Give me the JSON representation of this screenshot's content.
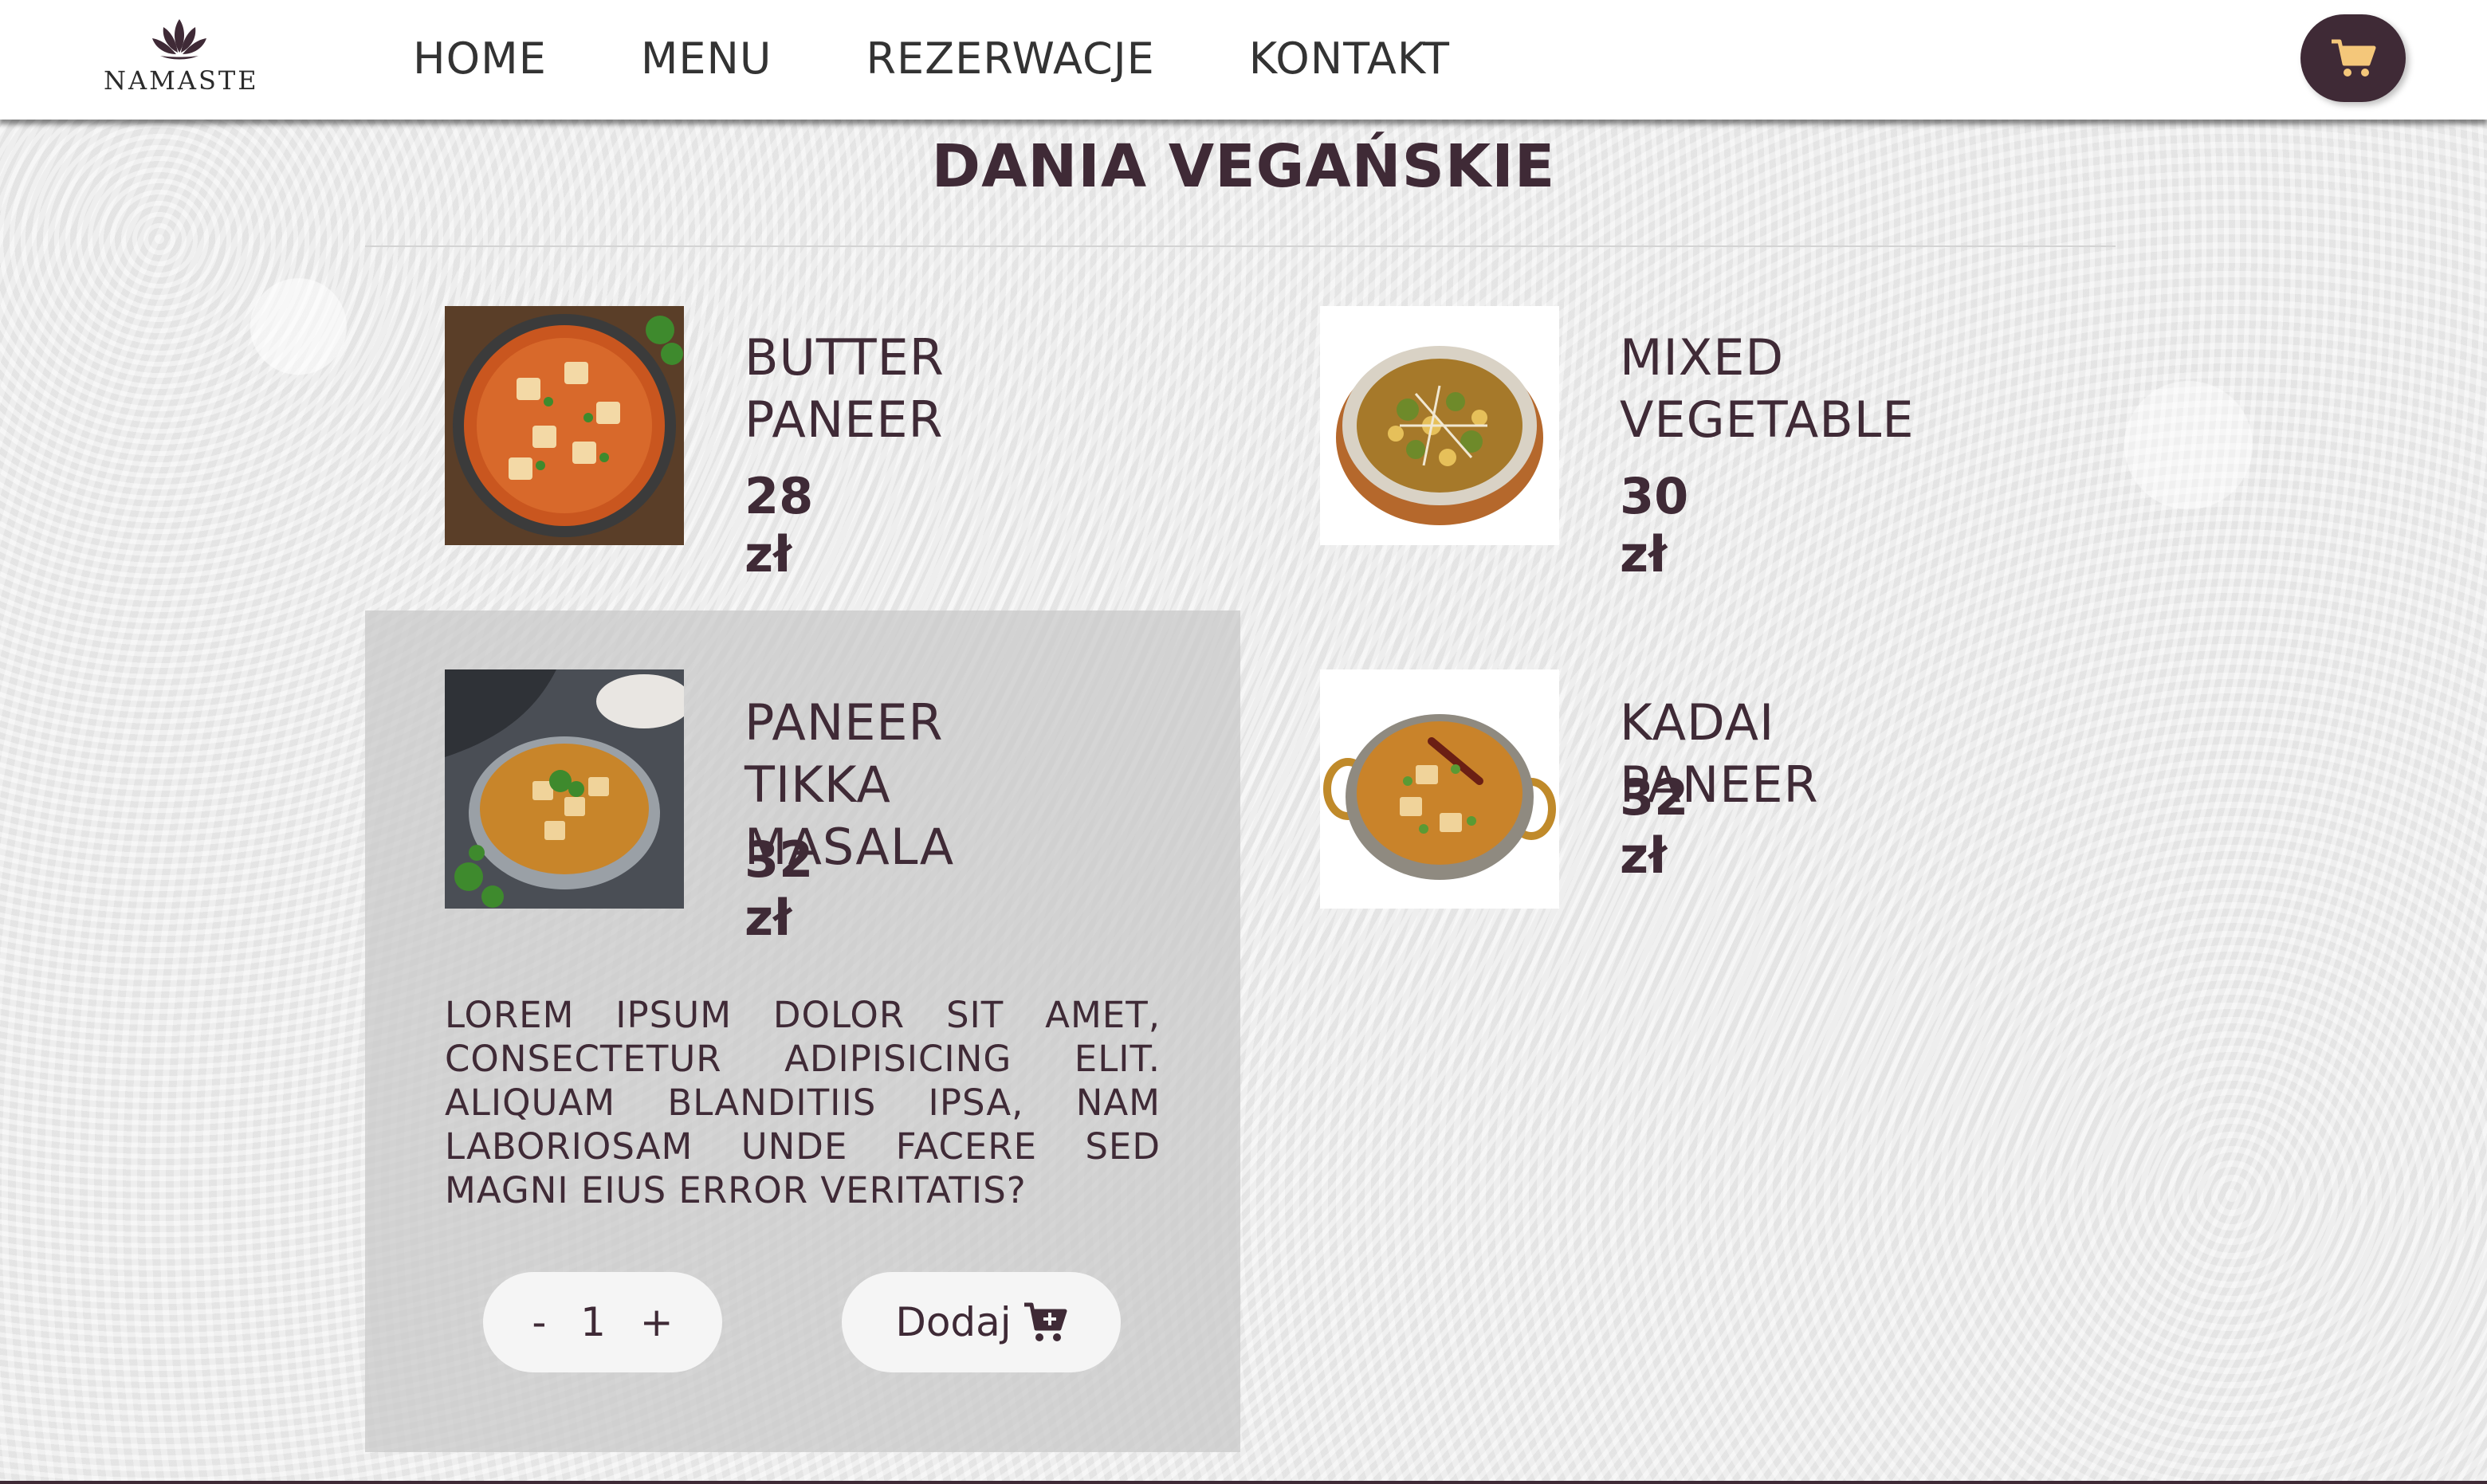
{
  "header": {
    "logo_text": "NAMASTE",
    "nav": [
      "HOME",
      "MENU",
      "REZERWACJE",
      "KONTAKT"
    ],
    "cart_icon": "cart-icon"
  },
  "page": {
    "title": "DANIA VEGAŃSKIE"
  },
  "dishes": [
    {
      "name": "BUTTER\nPANEER",
      "price": "28 zł",
      "image": "butter-paneer-image"
    },
    {
      "name": "MIXED\nVEGETABLE",
      "price": "30 zł",
      "image": "mixed-vegetable-image"
    },
    {
      "name": "PANEER TIKKA\nMASALA",
      "price": "32 zł",
      "image": "paneer-tikka-masala-image"
    },
    {
      "name": "KADAI PANEER",
      "price": "32 zł",
      "image": "kadai-paneer-image"
    }
  ],
  "selected": {
    "description": "LOREM IPSUM DOLOR SIT AMET, CONSECTETUR ADIPISICING ELIT. ALIQUAM BLANDITIIS IPSA, NAM LABORIOSAM UNDE FACERE SED MAGNI EIUS ERROR VERITATIS?",
    "quantity": {
      "minus": "-",
      "value": "1",
      "plus": "+"
    },
    "add_label": "Dodaj"
  },
  "colors": {
    "accent": "#3f2a36",
    "header_bg": "#ffffff",
    "panel_bg": "#c8c8c8"
  }
}
